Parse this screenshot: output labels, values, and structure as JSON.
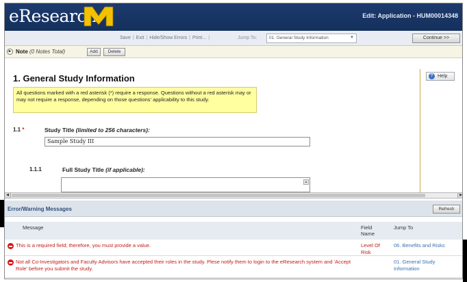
{
  "header": {
    "logo_text": "eResearch",
    "logo_mark": "M",
    "app_title": "Edit: Application - HUM00014348"
  },
  "toolbar": {
    "links": [
      "Save",
      "Exit",
      "Hide/Show Errors",
      "Print..."
    ],
    "jump_label": "Jump To:",
    "jump_selected": "01. General Study Information",
    "continue_label": "Continue >>"
  },
  "notes": {
    "label": "Note",
    "count_text": "(0 Notes Total)",
    "add_label": "Add",
    "delete_label": "Delete"
  },
  "section": {
    "title": "1. General Study Information",
    "info": "All questions marked with a red asterisk (*) require a response. Questions without a red asterisk may or may not require a response, depending on those questions' applicability to this study."
  },
  "questions": [
    {
      "number": "1.1",
      "required": "*",
      "label": "Study Title",
      "hint": "(limited to 256 characters):",
      "value": "Sample Study III"
    },
    {
      "number": "1.1.1",
      "label": "Full Study Title",
      "hint": "(if applicable):",
      "value": ""
    }
  ],
  "help": {
    "label": "Help"
  },
  "errors": {
    "title": "Error/Warning Messages",
    "refresh_label": "Refresh",
    "columns": {
      "message": "Message",
      "field": "Field Name",
      "jump": "Jump To"
    },
    "rows": [
      {
        "message": "This is a required field; therefore, you must provide a value.",
        "field": "Level Of Risk",
        "jump": "06. Benefits and Risks"
      },
      {
        "message": "Not all Co-Investigators and Faculty Advisors have accepted their roles in the study. Plese notify them to login to the eResearch system and 'Accept Role' before you submit the study.",
        "field": "",
        "jump": "01. General Study Information"
      }
    ]
  },
  "colors": {
    "header_bg": "#14305c",
    "logo_m": "#f2c200",
    "error_text": "#c41a1a",
    "link": "#3a6fb3",
    "info_box": "#ffffa0"
  }
}
